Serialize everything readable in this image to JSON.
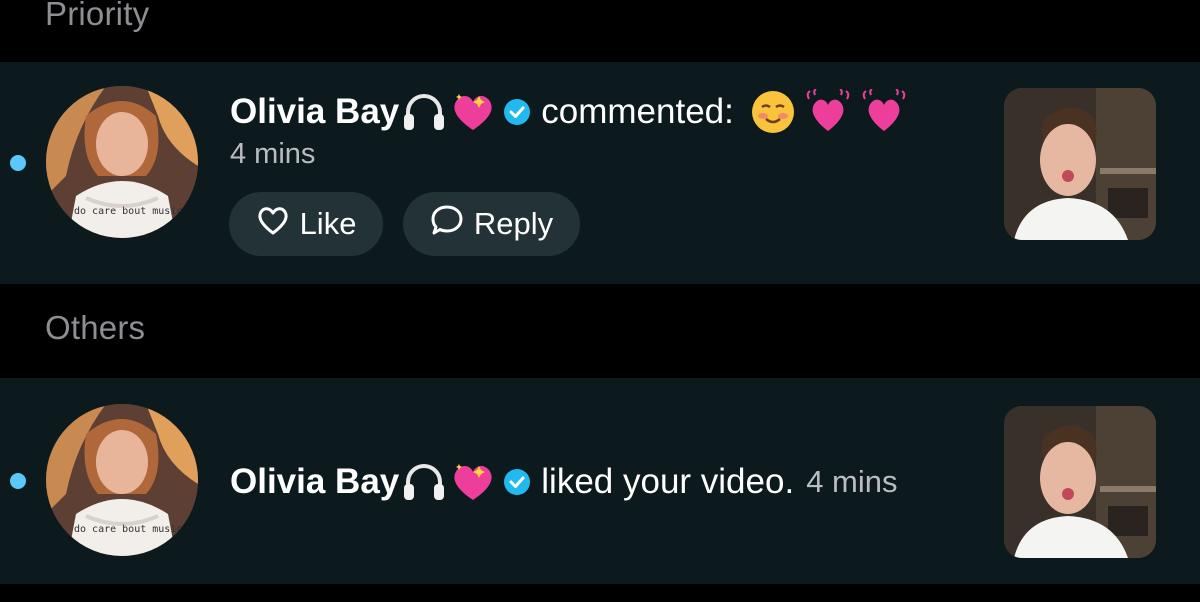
{
  "sections": {
    "priority": "Priority",
    "others": "Others"
  },
  "notifications": [
    {
      "username": "Olivia Bay",
      "action": "commented:",
      "time": "4 mins",
      "avatar_text": "do care bout music.",
      "unread": true,
      "badges": [
        "headphones-emoji",
        "sparkling-heart-emoji",
        "verified-badge"
      ],
      "comment_emojis": [
        "smiling-face-emoji",
        "beating-heart-emoji",
        "beating-heart-emoji"
      ],
      "buttons": {
        "like": "Like",
        "reply": "Reply"
      }
    },
    {
      "username": "Olivia Bay",
      "action": "liked your video.",
      "time": "4 mins",
      "avatar_text": "do care bout music.",
      "unread": true,
      "badges": [
        "headphones-emoji",
        "sparkling-heart-emoji",
        "verified-badge"
      ]
    }
  ],
  "colors": {
    "background": "#000000",
    "card": "#0d1a1d",
    "unread_dot": "#5ac8fa",
    "button": "#233236",
    "verified": "#20b9f0",
    "muted_text": "#8e8e93"
  }
}
